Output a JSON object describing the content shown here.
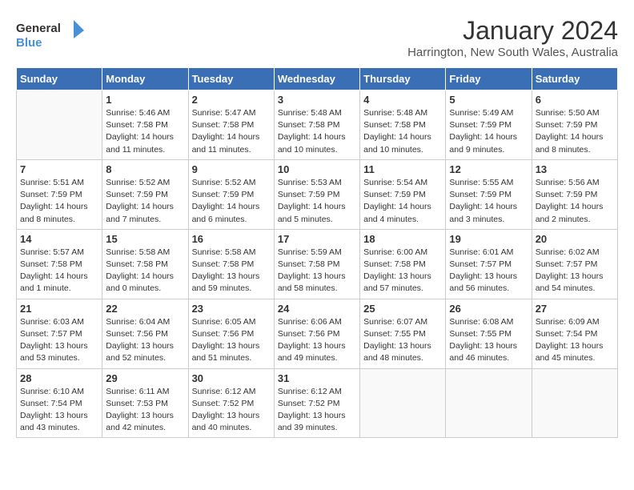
{
  "header": {
    "logo_line1": "General",
    "logo_line2": "Blue",
    "month": "January 2024",
    "location": "Harrington, New South Wales, Australia"
  },
  "days_of_week": [
    "Sunday",
    "Monday",
    "Tuesday",
    "Wednesday",
    "Thursday",
    "Friday",
    "Saturday"
  ],
  "weeks": [
    [
      {
        "day": "",
        "info": ""
      },
      {
        "day": "1",
        "info": "Sunrise: 5:46 AM\nSunset: 7:58 PM\nDaylight: 14 hours\nand 11 minutes."
      },
      {
        "day": "2",
        "info": "Sunrise: 5:47 AM\nSunset: 7:58 PM\nDaylight: 14 hours\nand 11 minutes."
      },
      {
        "day": "3",
        "info": "Sunrise: 5:48 AM\nSunset: 7:58 PM\nDaylight: 14 hours\nand 10 minutes."
      },
      {
        "day": "4",
        "info": "Sunrise: 5:48 AM\nSunset: 7:58 PM\nDaylight: 14 hours\nand 10 minutes."
      },
      {
        "day": "5",
        "info": "Sunrise: 5:49 AM\nSunset: 7:59 PM\nDaylight: 14 hours\nand 9 minutes."
      },
      {
        "day": "6",
        "info": "Sunrise: 5:50 AM\nSunset: 7:59 PM\nDaylight: 14 hours\nand 8 minutes."
      }
    ],
    [
      {
        "day": "7",
        "info": "Sunrise: 5:51 AM\nSunset: 7:59 PM\nDaylight: 14 hours\nand 8 minutes."
      },
      {
        "day": "8",
        "info": "Sunrise: 5:52 AM\nSunset: 7:59 PM\nDaylight: 14 hours\nand 7 minutes."
      },
      {
        "day": "9",
        "info": "Sunrise: 5:52 AM\nSunset: 7:59 PM\nDaylight: 14 hours\nand 6 minutes."
      },
      {
        "day": "10",
        "info": "Sunrise: 5:53 AM\nSunset: 7:59 PM\nDaylight: 14 hours\nand 5 minutes."
      },
      {
        "day": "11",
        "info": "Sunrise: 5:54 AM\nSunset: 7:59 PM\nDaylight: 14 hours\nand 4 minutes."
      },
      {
        "day": "12",
        "info": "Sunrise: 5:55 AM\nSunset: 7:59 PM\nDaylight: 14 hours\nand 3 minutes."
      },
      {
        "day": "13",
        "info": "Sunrise: 5:56 AM\nSunset: 7:59 PM\nDaylight: 14 hours\nand 2 minutes."
      }
    ],
    [
      {
        "day": "14",
        "info": "Sunrise: 5:57 AM\nSunset: 7:58 PM\nDaylight: 14 hours\nand 1 minute."
      },
      {
        "day": "15",
        "info": "Sunrise: 5:58 AM\nSunset: 7:58 PM\nDaylight: 14 hours\nand 0 minutes."
      },
      {
        "day": "16",
        "info": "Sunrise: 5:58 AM\nSunset: 7:58 PM\nDaylight: 13 hours\nand 59 minutes."
      },
      {
        "day": "17",
        "info": "Sunrise: 5:59 AM\nSunset: 7:58 PM\nDaylight: 13 hours\nand 58 minutes."
      },
      {
        "day": "18",
        "info": "Sunrise: 6:00 AM\nSunset: 7:58 PM\nDaylight: 13 hours\nand 57 minutes."
      },
      {
        "day": "19",
        "info": "Sunrise: 6:01 AM\nSunset: 7:57 PM\nDaylight: 13 hours\nand 56 minutes."
      },
      {
        "day": "20",
        "info": "Sunrise: 6:02 AM\nSunset: 7:57 PM\nDaylight: 13 hours\nand 54 minutes."
      }
    ],
    [
      {
        "day": "21",
        "info": "Sunrise: 6:03 AM\nSunset: 7:57 PM\nDaylight: 13 hours\nand 53 minutes."
      },
      {
        "day": "22",
        "info": "Sunrise: 6:04 AM\nSunset: 7:56 PM\nDaylight: 13 hours\nand 52 minutes."
      },
      {
        "day": "23",
        "info": "Sunrise: 6:05 AM\nSunset: 7:56 PM\nDaylight: 13 hours\nand 51 minutes."
      },
      {
        "day": "24",
        "info": "Sunrise: 6:06 AM\nSunset: 7:56 PM\nDaylight: 13 hours\nand 49 minutes."
      },
      {
        "day": "25",
        "info": "Sunrise: 6:07 AM\nSunset: 7:55 PM\nDaylight: 13 hours\nand 48 minutes."
      },
      {
        "day": "26",
        "info": "Sunrise: 6:08 AM\nSunset: 7:55 PM\nDaylight: 13 hours\nand 46 minutes."
      },
      {
        "day": "27",
        "info": "Sunrise: 6:09 AM\nSunset: 7:54 PM\nDaylight: 13 hours\nand 45 minutes."
      }
    ],
    [
      {
        "day": "28",
        "info": "Sunrise: 6:10 AM\nSunset: 7:54 PM\nDaylight: 13 hours\nand 43 minutes."
      },
      {
        "day": "29",
        "info": "Sunrise: 6:11 AM\nSunset: 7:53 PM\nDaylight: 13 hours\nand 42 minutes."
      },
      {
        "day": "30",
        "info": "Sunrise: 6:12 AM\nSunset: 7:52 PM\nDaylight: 13 hours\nand 40 minutes."
      },
      {
        "day": "31",
        "info": "Sunrise: 6:12 AM\nSunset: 7:52 PM\nDaylight: 13 hours\nand 39 minutes."
      },
      {
        "day": "",
        "info": ""
      },
      {
        "day": "",
        "info": ""
      },
      {
        "day": "",
        "info": ""
      }
    ]
  ]
}
